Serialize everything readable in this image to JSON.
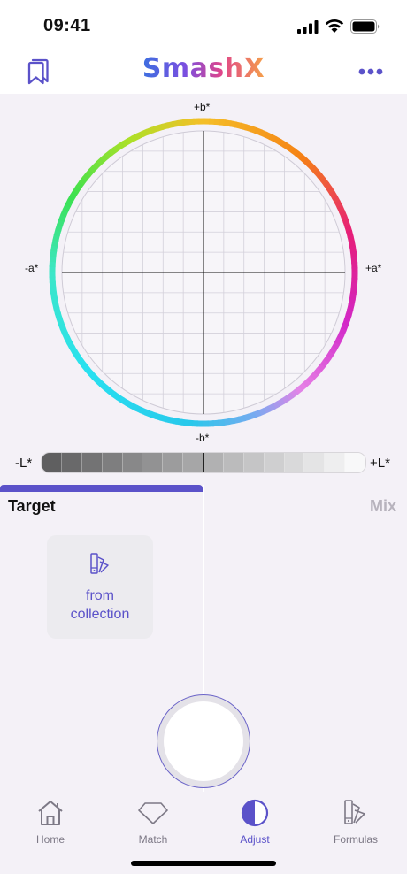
{
  "status_bar": {
    "time": "09:41",
    "icons": [
      "cellular-signal-icon",
      "wifi-icon",
      "battery-icon"
    ]
  },
  "header": {
    "title": "SmashX",
    "left_icon": "bookmarks-icon",
    "right_icon": "more-dots-icon",
    "accent": "#5b52c9"
  },
  "color_space": {
    "axes": {
      "top": "+b*",
      "bottom": "-b*",
      "left": "-a*",
      "right": "+a*"
    },
    "lightness": {
      "left": "-L*",
      "right": "+L*"
    }
  },
  "tabs": {
    "target": "Target",
    "mix": "Mix",
    "active": "Target"
  },
  "target": {
    "collection_button": {
      "line1": "from",
      "line2": "collection",
      "icon": "color-fan-icon"
    }
  },
  "nav": {
    "items": [
      {
        "label": "Home",
        "icon": "home-icon",
        "active": false
      },
      {
        "label": "Match",
        "icon": "gem-icon",
        "active": false
      },
      {
        "label": "Adjust",
        "icon": "half-circle-icon",
        "active": true
      },
      {
        "label": "Formulas",
        "icon": "color-fan-icon",
        "active": false
      }
    ]
  },
  "colors": {
    "accent": "#5b52c9",
    "panel_bg": "#f4f1f7"
  }
}
